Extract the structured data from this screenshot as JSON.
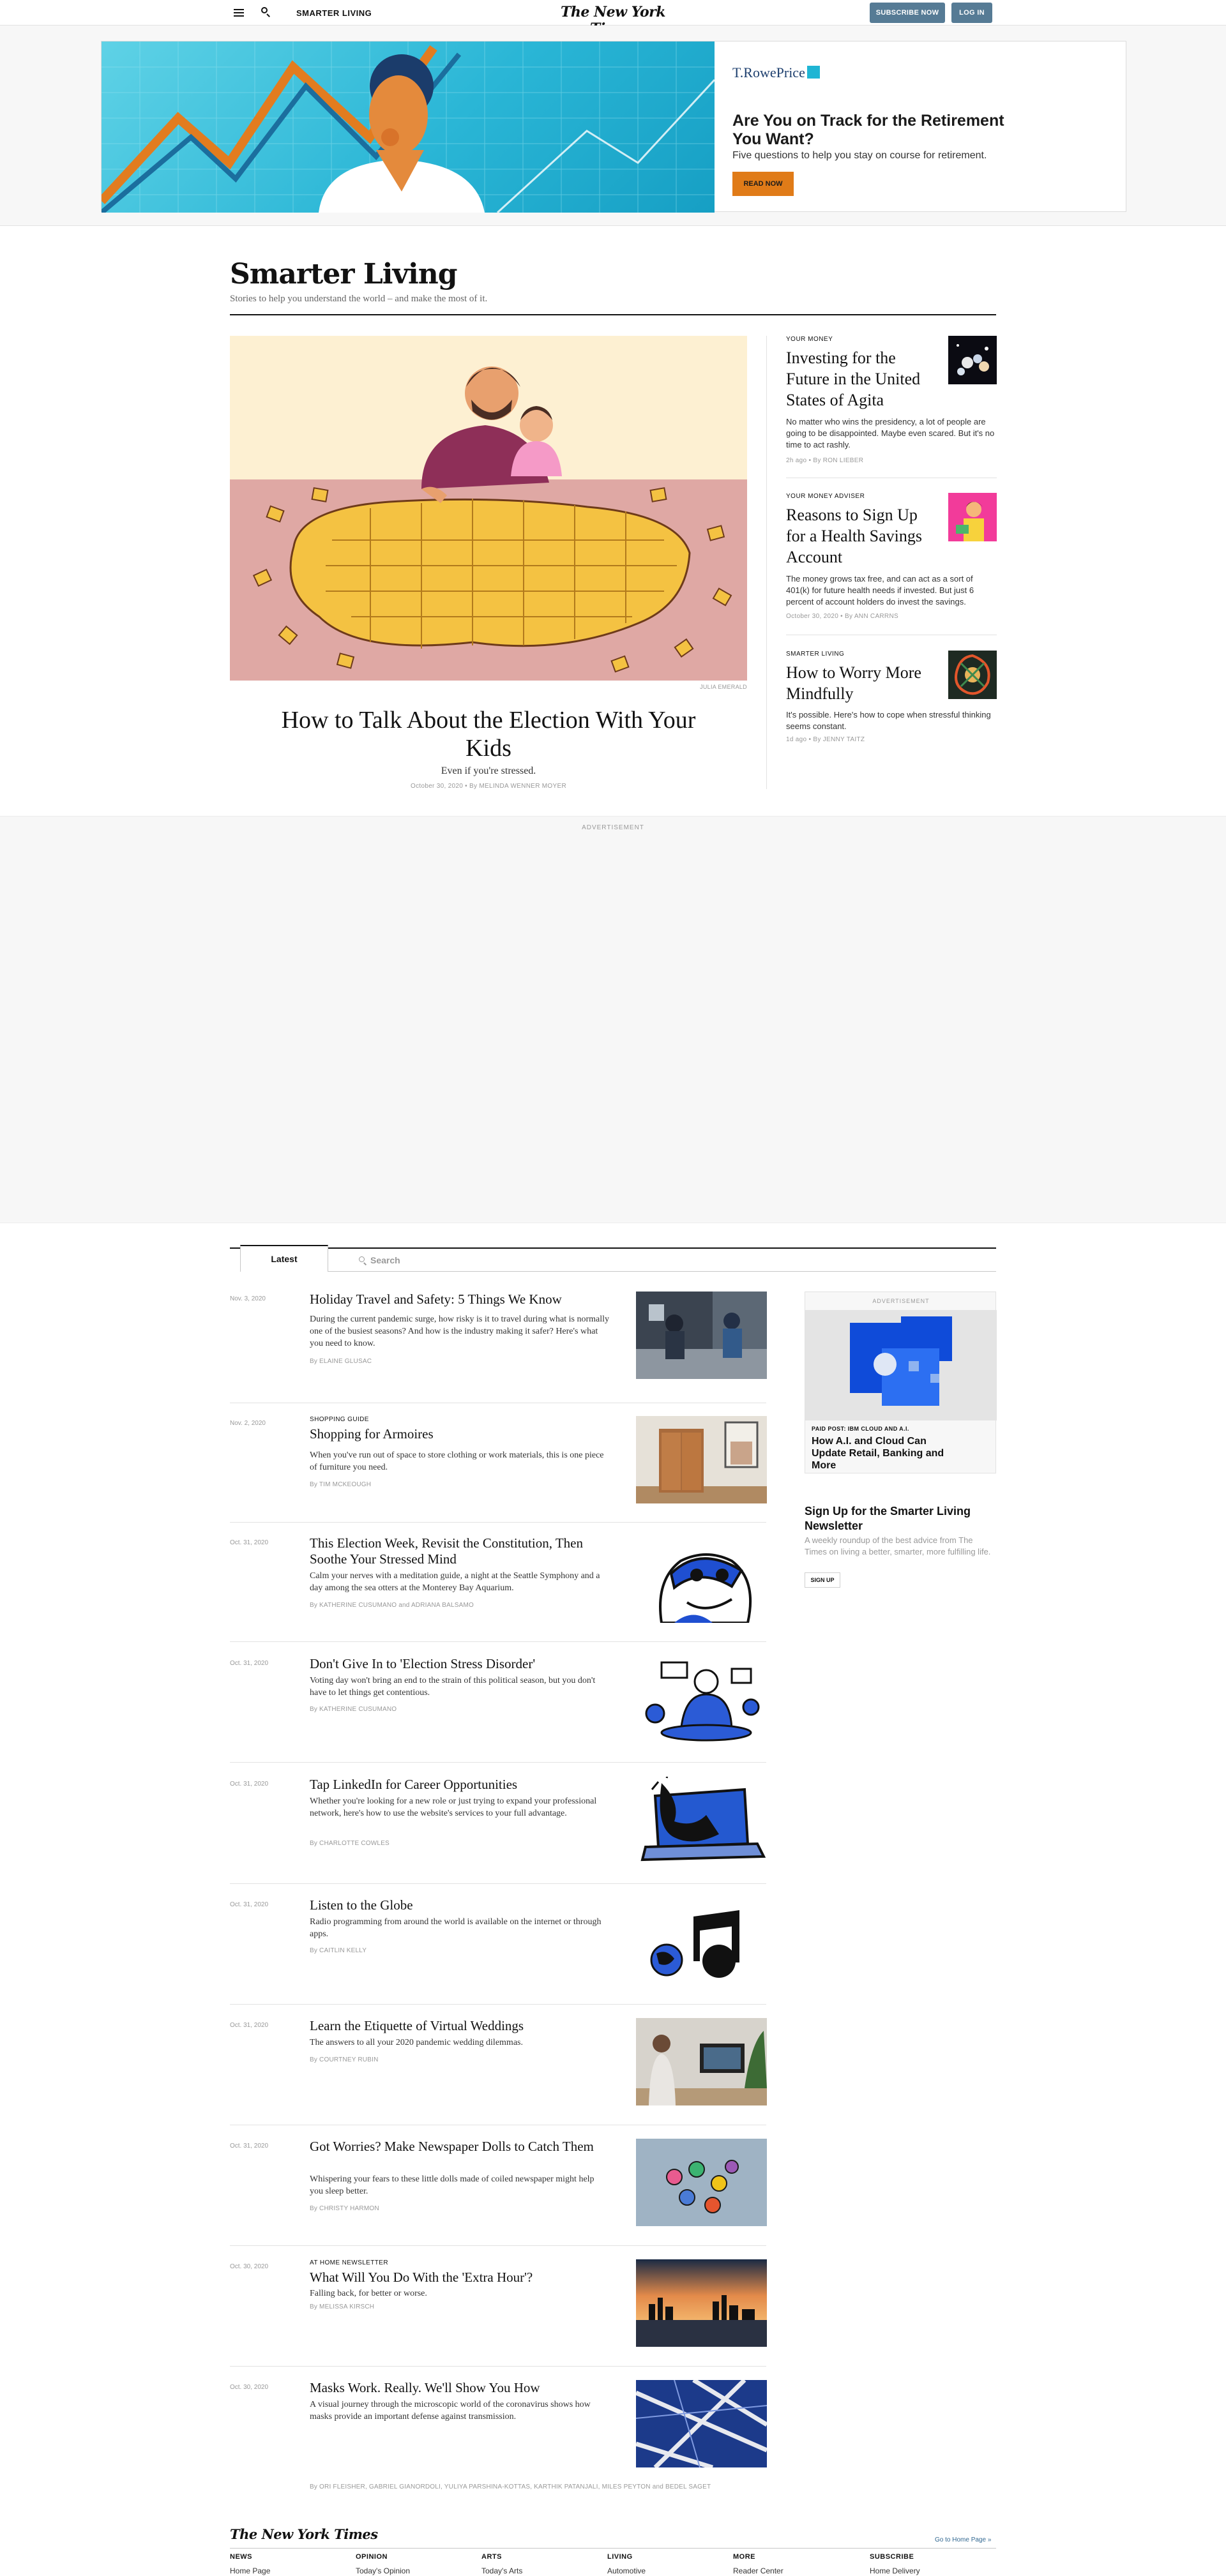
{
  "topbar": {
    "section": "SMARTER LIVING",
    "logo": "The New York Times",
    "subscribe": "SUBSCRIBE NOW",
    "login": "LOG IN"
  },
  "ad": {
    "brand": "T.RowePrice",
    "headline": "Are You on Track for the Retirement You Want?",
    "subline": "Five questions to help you stay on course for retirement.",
    "cta": "READ NOW"
  },
  "section": {
    "title": "Smarter Living",
    "tagline": "Stories to help you understand the world – and make the most of it."
  },
  "hero": {
    "credit": "JULIA EMERALD",
    "title": "How to Talk About the Election With Your Kids",
    "summary": "Even if you're stressed.",
    "meta": "October 30, 2020 • By MELINDA WENNER MOYER"
  },
  "side": [
    {
      "kicker": "YOUR MONEY",
      "title": "Investing for the Future in the United States of Agita",
      "summary": "No matter who wins the presidency, a lot of people are going to be disappointed. Maybe even scared. But it's no time to act rashly.",
      "meta": "2h ago • By RON LIEBER"
    },
    {
      "kicker": "YOUR MONEY ADVISER",
      "title": "Reasons to Sign Up for a Health Savings Account",
      "summary": "The money grows tax free, and can act as a sort of 401(k) for future health needs if invested. But just 6 percent of account holders do invest the savings.",
      "meta": "October 30, 2020 • By ANN CARRNS"
    },
    {
      "kicker": "SMARTER LIVING",
      "title": "How to Worry More Mindfully",
      "summary": "It's possible. Here's how to cope when stressful thinking seems constant.",
      "meta": "1d ago • By JENNY TAITZ"
    }
  ],
  "bigad": {
    "label": "ADVERTISEMENT"
  },
  "tabs": {
    "latest": "Latest",
    "search_placeholder": "Search"
  },
  "stream": [
    {
      "date": "Nov. 3, 2020",
      "kicker": "",
      "title": "Holiday Travel and Safety: 5 Things We Know",
      "summary": "During the current pandemic surge, how risky is it to travel during what is normally one of the busiest seasons? And how is the industry making it safer? Here's what you need to know.",
      "byline": "By ELAINE GLUSAC"
    },
    {
      "date": "Nov. 2, 2020",
      "kicker": "SHOPPING GUIDE",
      "title": "Shopping for Armoires",
      "summary": "When you've run out of space to store clothing or work materials, this is one piece of furniture you need.",
      "byline": "By TIM MCKEOUGH"
    },
    {
      "date": "Oct. 31, 2020",
      "kicker": "",
      "title": "This Election Week, Revisit the Constitution, Then Soothe Your Stressed Mind",
      "summary": "Calm your nerves with a meditation guide, a night at the Seattle Symphony and a day among the sea otters at the Monterey Bay Aquarium.",
      "byline": "By KATHERINE CUSUMANO and ADRIANA BALSAMO"
    },
    {
      "date": "Oct. 31, 2020",
      "kicker": "",
      "title": "Don't Give In to 'Election Stress Disorder'",
      "summary": "Voting day won't bring an end to the strain of this political season, but you don't have to let things get contentious.",
      "byline": "By KATHERINE CUSUMANO"
    },
    {
      "date": "Oct. 31, 2020",
      "kicker": "",
      "title": "Tap LinkedIn for Career Opportunities",
      "summary": "Whether you're looking for a new role or just trying to expand your professional network, here's how to use the website's services to your full advantage.",
      "byline": "By CHARLOTTE COWLES"
    },
    {
      "date": "Oct. 31, 2020",
      "kicker": "",
      "title": "Listen to the Globe",
      "summary": "Radio programming from around the world is available on the internet or through apps.",
      "byline": "By CAITLIN KELLY"
    },
    {
      "date": "Oct. 31, 2020",
      "kicker": "",
      "title": "Learn the Etiquette of Virtual Weddings",
      "summary": "The answers to all your 2020 pandemic wedding dilemmas.",
      "byline": "By COURTNEY RUBIN"
    },
    {
      "date": "Oct. 31, 2020",
      "kicker": "",
      "title": "Got Worries? Make Newspaper Dolls to Catch Them",
      "summary": "Whispering your fears to these little dolls made of coiled newspaper might help you sleep better.",
      "byline": "By CHRISTY HARMON"
    },
    {
      "date": "Oct. 30, 2020",
      "kicker": "AT HOME NEWSLETTER",
      "title": "What Will You Do With the 'Extra Hour'?",
      "summary": "Falling back, for better or worse.",
      "byline": "By MELISSA KIRSCH"
    },
    {
      "date": "Oct. 30, 2020",
      "kicker": "",
      "title": "Masks Work. Really. We'll Show You How",
      "summary": "A visual journey through the microscopic world of the coronavirus shows how masks provide an important defense against transmission.",
      "byline": "By ORI FLEISHER, GABRIEL GIANORDOLI, YULIYA PARSHINA-KOTTAS, KARTHIK PATANJALI, MILES PEYTON and BEDEL SAGET"
    }
  ],
  "rail": {
    "ad_label": "ADVERTISEMENT",
    "ad_kicker": "PAID POST: IBM CLOUD AND A.I.",
    "ad_title": "How A.I. and Cloud Can Update Retail, Banking and More",
    "nl_title": "Sign Up for the Smarter Living Newsletter",
    "nl_summary": "A weekly roundup of the best advice from The Times on living a better, smarter, more fulfilling life.",
    "nl_button": "SIGN UP"
  },
  "footer": {
    "logo": "The New York Times",
    "home": "Go to Home Page »",
    "cols": [
      "NEWS",
      "OPINION",
      "ARTS",
      "LIVING",
      "MORE",
      "SUBSCRIBE"
    ],
    "links": [
      "Home Page",
      "Today's Opinion",
      "Today's Arts",
      "Automotive",
      "Reader Center",
      "Home Delivery"
    ]
  }
}
